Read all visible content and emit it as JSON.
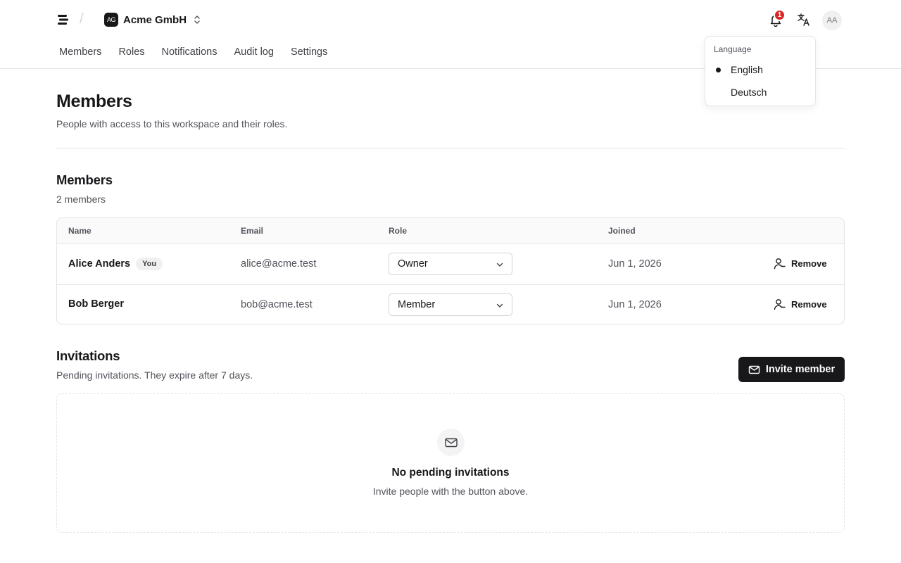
{
  "header": {
    "workspace_initials": "AG",
    "workspace_name": "Acme GmbH",
    "notification_count": "1",
    "user_initials": "AA"
  },
  "nav": {
    "items": [
      {
        "label": "Members"
      },
      {
        "label": "Roles"
      },
      {
        "label": "Notifications"
      },
      {
        "label": "Audit log"
      },
      {
        "label": "Settings"
      }
    ]
  },
  "page": {
    "title": "Members",
    "subtitle": "People with access to this workspace and their roles."
  },
  "members": {
    "title": "Members",
    "count": "2 members",
    "columns": {
      "name": "Name",
      "email": "Email",
      "role": "Role",
      "joined": "Joined"
    },
    "rows": [
      {
        "name": "Alice Anders",
        "badge": "You",
        "email": "alice@acme.test",
        "role": "Owner",
        "joined": "Jun 1, 2026",
        "action": "Remove"
      },
      {
        "name": "Bob Berger",
        "badge": "",
        "email": "bob@acme.test",
        "role": "Member",
        "joined": "Jun 1, 2026",
        "action": "Remove"
      }
    ]
  },
  "invitations": {
    "title": "Invitations",
    "subtitle": "Pending invitations. They expire after 7 days.",
    "invite_label": "Invite member",
    "empty_title": "No pending invitations",
    "empty_subtitle": "Invite people with the button above."
  },
  "language_menu": {
    "label": "Language",
    "options": [
      {
        "label": "English",
        "selected": true
      },
      {
        "label": "Deutsch",
        "selected": false
      }
    ]
  },
  "colors": {
    "primary": "#18181b",
    "badge_red": "#dc2626",
    "border": "#e4e4e7",
    "muted_text": "#52525b"
  },
  "icons": [
    "logo-icon",
    "chevron-up-down-icon",
    "bell-icon",
    "translate-icon",
    "chevron-down-icon",
    "user-minus-icon",
    "mail-icon"
  ]
}
